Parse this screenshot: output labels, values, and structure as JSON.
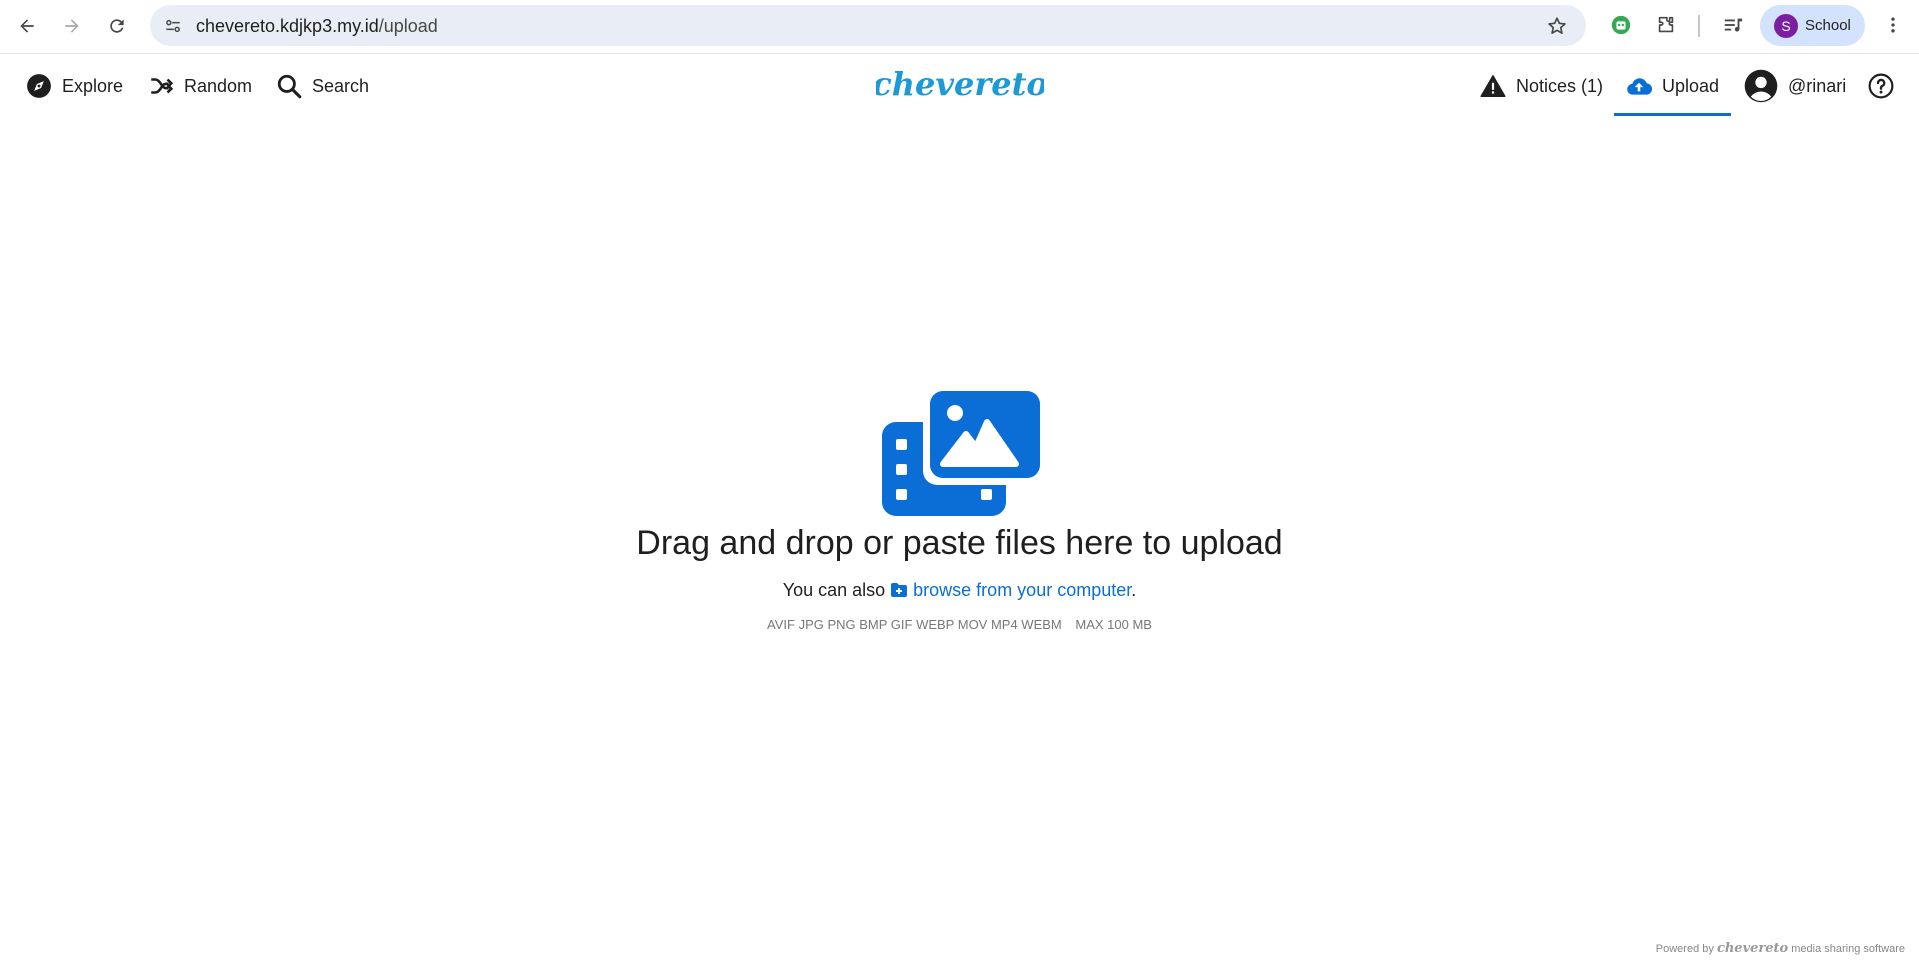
{
  "browser": {
    "url_host": "chevereto.kdjkp3.my.id",
    "url_path": "/upload",
    "profile_initial": "S",
    "profile_label": "School"
  },
  "site_nav": {
    "left": [
      {
        "label": "Explore",
        "icon": "compass-icon"
      },
      {
        "label": "Random",
        "icon": "shuffle-icon"
      },
      {
        "label": "Search",
        "icon": "search-icon"
      }
    ],
    "logo_text": "chevereto",
    "right": {
      "notices_label": "Notices (1)",
      "upload_label": "Upload",
      "user_label": "@rinari"
    },
    "active_item": "Upload"
  },
  "upload": {
    "heading": "Drag and drop or paste files here to upload",
    "browse_prefix": "You can also",
    "browse_link": "browse from your computer",
    "browse_suffix": ".",
    "formats": "AVIF JPG PNG BMP GIF WEBP MOV MP4 WEBM",
    "max_size": "MAX 100 MB"
  },
  "footer": {
    "powered_by": "Powered by",
    "brand": "chevereto",
    "tagline": "media sharing software"
  },
  "colors": {
    "accent": "#0a6ed6",
    "logo": "#1d9ad6",
    "omnibox": "#e9eef6",
    "profile_chip": "#d3e3fd"
  }
}
